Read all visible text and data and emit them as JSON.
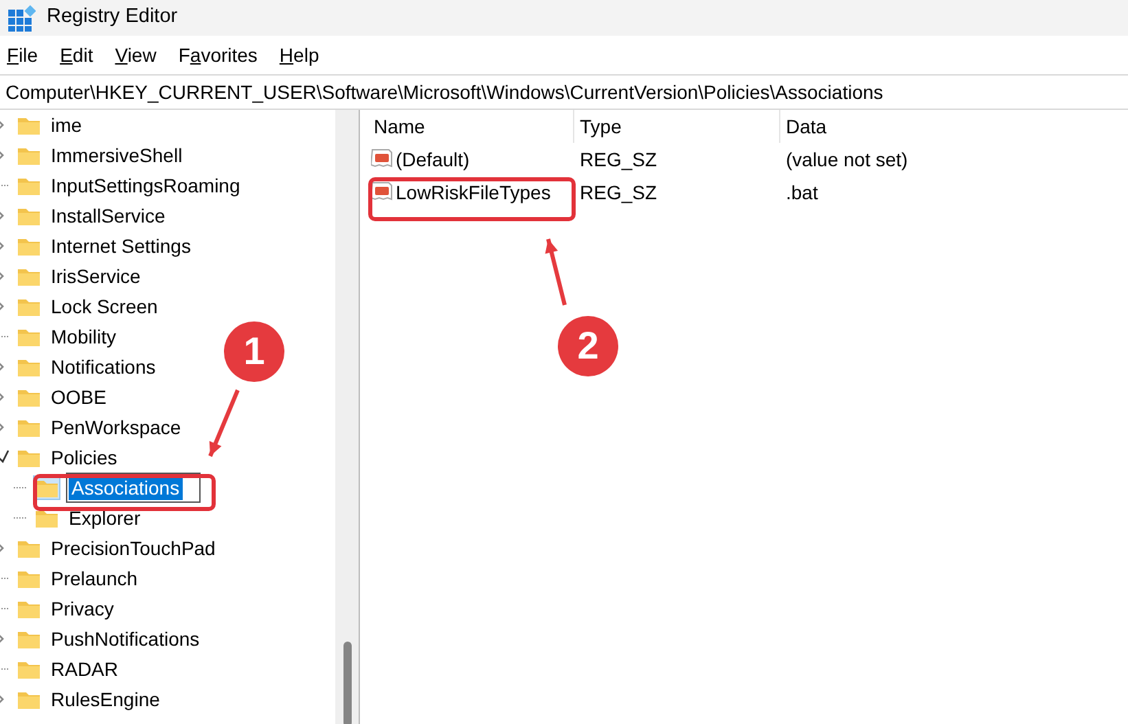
{
  "window": {
    "title": "Registry Editor"
  },
  "menu": [
    {
      "parts": [
        {
          "text": "F",
          "underlined": true
        },
        {
          "text": "ile",
          "underlined": false
        }
      ]
    },
    {
      "parts": [
        {
          "text": "E",
          "underlined": true
        },
        {
          "text": "dit",
          "underlined": false
        }
      ]
    },
    {
      "parts": [
        {
          "text": "V",
          "underlined": true
        },
        {
          "text": "iew",
          "underlined": false
        }
      ]
    },
    {
      "parts": [
        {
          "text": "F",
          "underlined": false
        },
        {
          "text": "a",
          "underlined": true
        },
        {
          "text": "vorites",
          "underlined": false
        }
      ]
    },
    {
      "parts": [
        {
          "text": "H",
          "underlined": true
        },
        {
          "text": "elp",
          "underlined": false
        }
      ]
    }
  ],
  "address": "Computer\\HKEY_CURRENT_USER\\Software\\Microsoft\\Windows\\CurrentVersion\\Policies\\Associations",
  "tree": [
    {
      "label": "ime",
      "kind": "branch",
      "expanded": false,
      "selected": false
    },
    {
      "label": "ImmersiveShell",
      "kind": "branch",
      "expanded": false,
      "selected": false
    },
    {
      "label": "InputSettingsRoaming",
      "kind": "leaf",
      "selected": false
    },
    {
      "label": "InstallService",
      "kind": "branch",
      "expanded": false,
      "selected": false
    },
    {
      "label": "Internet Settings",
      "kind": "branch",
      "expanded": false,
      "selected": false
    },
    {
      "label": "IrisService",
      "kind": "branch",
      "expanded": false,
      "selected": false
    },
    {
      "label": "Lock Screen",
      "kind": "branch",
      "expanded": false,
      "selected": false
    },
    {
      "label": "Mobility",
      "kind": "leaf",
      "selected": false
    },
    {
      "label": "Notifications",
      "kind": "branch",
      "expanded": false,
      "selected": false
    },
    {
      "label": "OOBE",
      "kind": "branch",
      "expanded": false,
      "selected": false
    },
    {
      "label": "PenWorkspace",
      "kind": "branch",
      "expanded": false,
      "selected": false
    },
    {
      "label": "Policies",
      "kind": "branch",
      "expanded": true,
      "selected": false,
      "children": [
        {
          "label": "Associations",
          "kind": "leaf",
          "selected": true
        },
        {
          "label": "Explorer",
          "kind": "leaf",
          "selected": false
        }
      ]
    },
    {
      "label": "PrecisionTouchPad",
      "kind": "branch",
      "expanded": false,
      "selected": false
    },
    {
      "label": "Prelaunch",
      "kind": "leaf",
      "selected": false
    },
    {
      "label": "Privacy",
      "kind": "leaf",
      "selected": false
    },
    {
      "label": "PushNotifications",
      "kind": "branch",
      "expanded": false,
      "selected": false
    },
    {
      "label": "RADAR",
      "kind": "leaf",
      "selected": false
    },
    {
      "label": "RulesEngine",
      "kind": "branch",
      "expanded": false,
      "selected": false
    }
  ],
  "values": {
    "columns": [
      "Name",
      "Type",
      "Data"
    ],
    "rows": [
      {
        "name": "(Default)",
        "type": "REG_SZ",
        "data": "(value not set)"
      },
      {
        "name": "LowRiskFileTypes",
        "type": "REG_SZ",
        "data": ".bat"
      }
    ]
  },
  "annotations": [
    {
      "label": "1"
    },
    {
      "label": "2"
    }
  ]
}
